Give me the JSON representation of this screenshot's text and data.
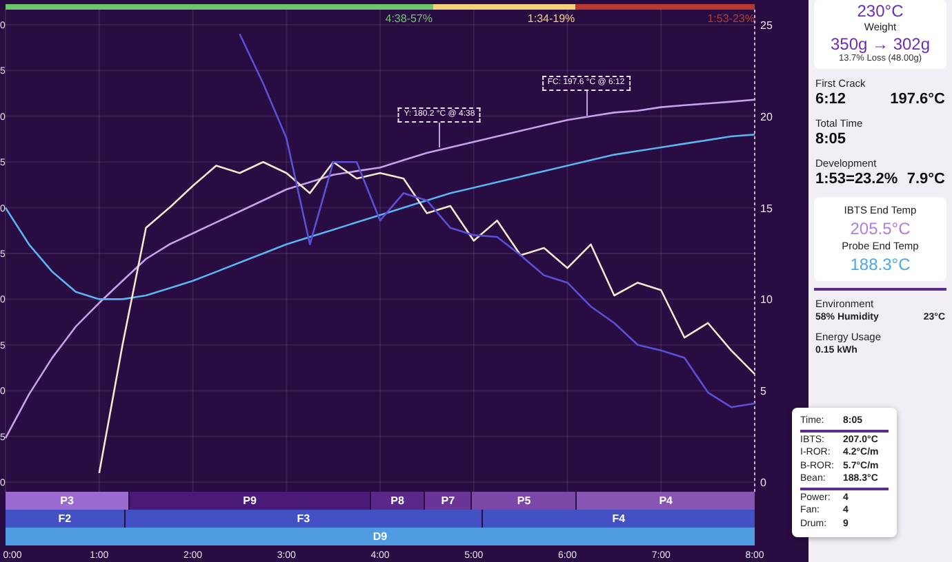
{
  "phase_bar": [
    {
      "label": "4:38-57%",
      "color": "#6cc76b"
    },
    {
      "label": "1:34-19%",
      "color": "#f3d27a"
    },
    {
      "label": "1:53-23%",
      "color": "#b83a2e"
    }
  ],
  "chart": {
    "left_axis_labels": [
      "0",
      "5",
      "0",
      "5",
      "0",
      "5",
      "0",
      "5",
      "0",
      "5",
      "0"
    ],
    "chart_data": {
      "type": "line",
      "x": [
        0,
        0.25,
        0.5,
        0.75,
        1,
        1.25,
        1.5,
        1.75,
        2,
        2.25,
        2.5,
        2.75,
        3,
        3.25,
        3.5,
        3.75,
        4,
        4.25,
        4.5,
        4.75,
        5,
        5.25,
        5.5,
        5.75,
        6,
        6.25,
        6.5,
        6.75,
        7,
        7.25,
        7.5,
        7.75,
        8
      ],
      "series": [
        {
          "color": "#c9a0ea",
          "values": [
            2.4,
            4.8,
            6.8,
            8.5,
            9.8,
            11.0,
            12.2,
            13.0,
            13.6,
            14.2,
            14.8,
            15.4,
            16.0,
            16.4,
            16.8,
            17.0,
            17.2,
            17.6,
            18.0,
            18.3,
            18.6,
            18.9,
            19.2,
            19.5,
            19.8,
            20.0,
            20.2,
            20.3,
            20.5,
            20.6,
            20.7,
            20.8,
            20.9
          ]
        },
        {
          "color": "#5bb4f0",
          "values": [
            15.0,
            13.0,
            11.5,
            10.4,
            10.0,
            10.0,
            10.2,
            10.6,
            11.0,
            11.5,
            12.0,
            12.5,
            13.0,
            13.4,
            13.8,
            14.2,
            14.6,
            15.0,
            15.4,
            15.8,
            16.1,
            16.4,
            16.7,
            17.0,
            17.3,
            17.6,
            17.9,
            18.1,
            18.3,
            18.5,
            18.7,
            18.9,
            19.0
          ]
        },
        {
          "color": "#f2e8cc",
          "values": [
            null,
            null,
            null,
            null,
            0.5,
            7.5,
            13.9,
            15.0,
            16.2,
            17.3,
            16.9,
            17.5,
            16.9,
            15.8,
            17.5,
            16.6,
            16.9,
            16.6,
            14.7,
            15.1,
            13.2,
            14.3,
            12.4,
            12.8,
            11.7,
            13.0,
            10.2,
            10.9,
            10.5,
            7.9,
            8.7,
            7.2,
            5.9
          ]
        },
        {
          "color": "#5a50d8",
          "values": [
            null,
            null,
            null,
            null,
            null,
            null,
            null,
            null,
            null,
            null,
            24.5,
            21.8,
            18.8,
            13.0,
            17.5,
            17.5,
            14.3,
            15.8,
            15.4,
            13.9,
            13.5,
            13.4,
            12.4,
            11.3,
            10.9,
            9.6,
            8.7,
            7.5,
            7.2,
            6.8,
            4.9,
            4.1,
            4.3
          ]
        }
      ],
      "xlim": [
        0,
        8
      ],
      "ylim": [
        0,
        25
      ],
      "xticks": [
        {
          "value": 0,
          "label": "0:00"
        },
        {
          "value": 1,
          "label": "1:00"
        },
        {
          "value": 2,
          "label": "2:00"
        },
        {
          "value": 3,
          "label": "3:00"
        },
        {
          "value": 4,
          "label": "4:00"
        },
        {
          "value": 5,
          "label": "5:00"
        },
        {
          "value": 6,
          "label": "6:00"
        },
        {
          "value": 7,
          "label": "7:00"
        },
        {
          "value": 8,
          "label": "8:00"
        }
      ],
      "yticks": [
        0,
        5,
        10,
        15,
        20,
        25
      ],
      "grid": true,
      "annotations": [
        "Y: 180.2 °C @ 4:38",
        "FC: 197.6 °C @ 6:12"
      ]
    }
  },
  "bands": [
    {
      "segments": [
        {
          "label": "P3",
          "color": "#9a6ccf"
        },
        {
          "label": "P9",
          "color": "#4a1a78"
        },
        {
          "label": "P8",
          "color": "#5a2888"
        },
        {
          "label": "P7",
          "color": "#6a3596"
        },
        {
          "label": "P5",
          "color": "#7b48a8"
        },
        {
          "label": "P4",
          "color": "#8656b2"
        }
      ]
    },
    {
      "segments": [
        {
          "label": "F2",
          "color": "#4350c2"
        },
        {
          "label": "F3",
          "color": "#4350c2"
        },
        {
          "label": "F4",
          "color": "#4350c2"
        }
      ]
    },
    {
      "segments": [
        {
          "label": "D9",
          "color": "#4f9be2"
        }
      ]
    }
  ],
  "sidebar": {
    "top_value": "230°C",
    "weight": {
      "label": "Weight",
      "value": "350g → 302g",
      "loss": "13.7% Loss (48.00g)"
    },
    "stats": [
      {
        "label": "First Crack",
        "values": [
          "6:12",
          "197.6°C"
        ]
      },
      {
        "label": "Total Time",
        "values": [
          "8:05"
        ]
      },
      {
        "label": "Development",
        "values": [
          "1:53=23.2%",
          "7.9°C"
        ]
      }
    ],
    "end_temps": [
      {
        "kind": "ibts",
        "label": "IBTS End Temp",
        "value": "205.5°C"
      },
      {
        "kind": "probe",
        "label": "Probe End Temp",
        "value": "188.3°C"
      }
    ],
    "environment": {
      "label": "Environment",
      "values": [
        "58% Humidity",
        "23°C"
      ]
    },
    "energy": {
      "label": "Energy Usage",
      "value": "0.15 kWh"
    }
  },
  "tooltip": {
    "groups": [
      [
        {
          "label": "Time:",
          "value": "8:05"
        }
      ],
      [
        {
          "label": "IBTS:",
          "value": "207.0°C"
        },
        {
          "label": "I-ROR:",
          "value": "4.2°C/m"
        },
        {
          "label": "B-ROR:",
          "value": "5.7°C/m"
        },
        {
          "label": "Bean:",
          "value": "188.3°C"
        }
      ],
      [
        {
          "label": "Power:",
          "value": "4"
        },
        {
          "label": "Fan:",
          "value": "4"
        },
        {
          "label": "Drum:",
          "value": "9"
        }
      ]
    ]
  }
}
